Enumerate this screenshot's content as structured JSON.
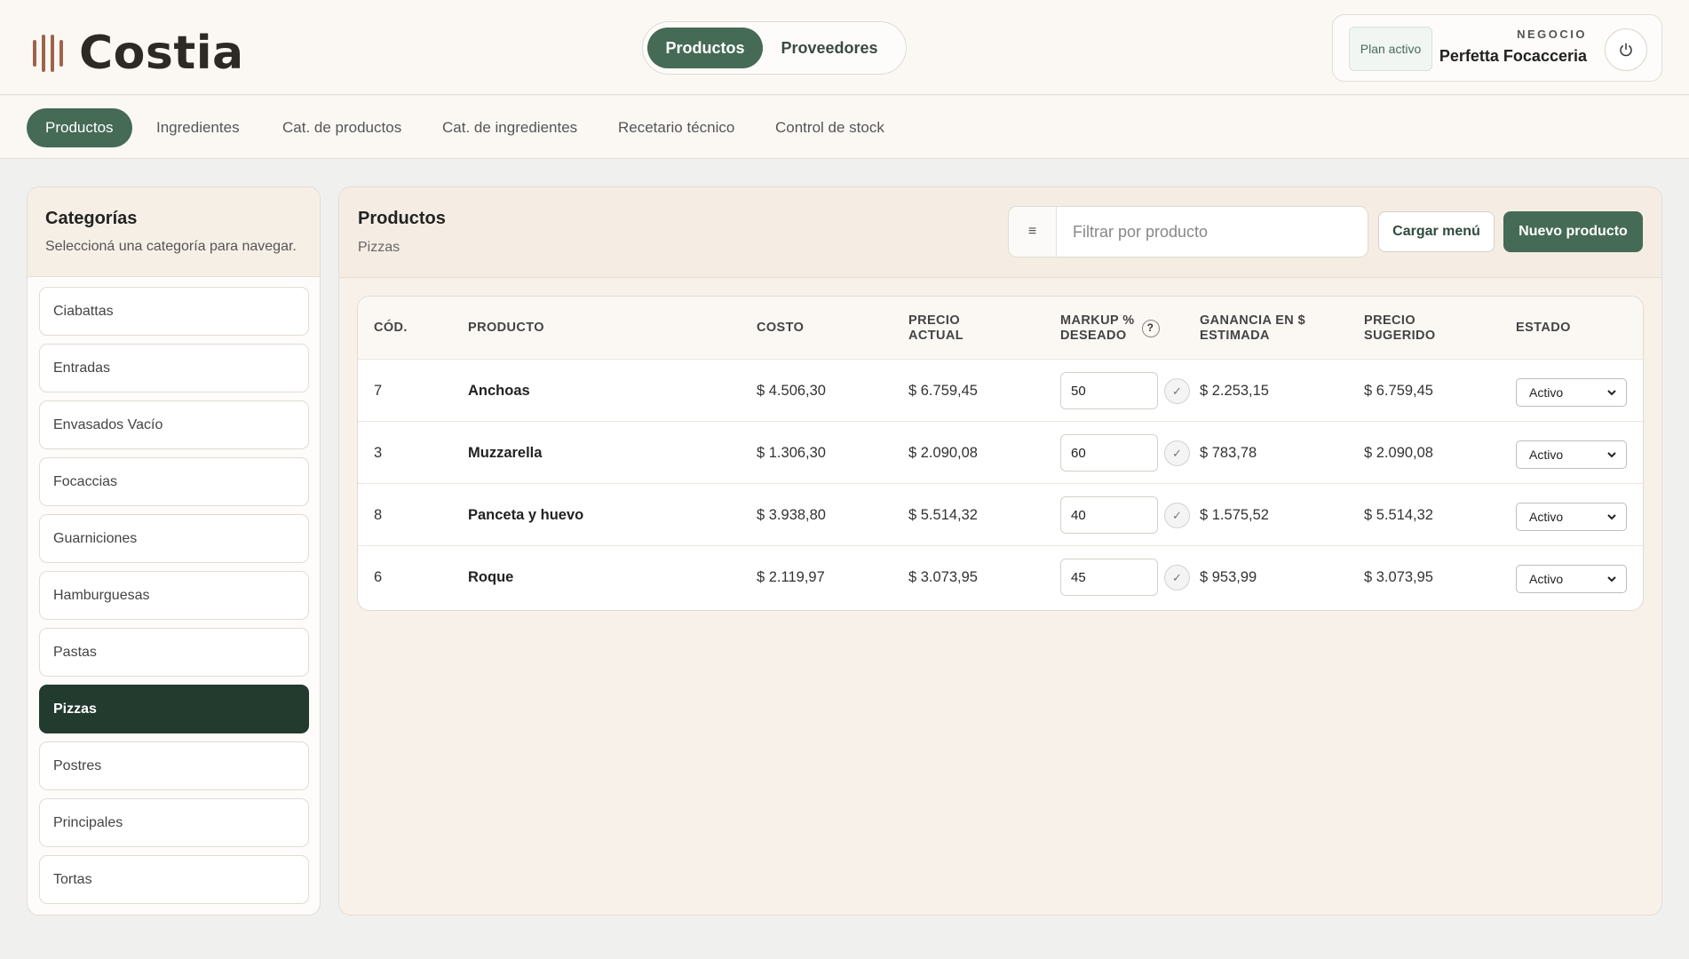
{
  "app": {
    "name": "Costia"
  },
  "top_toggle": {
    "active": "Productos",
    "inactive": "Proveedores"
  },
  "business": {
    "plan": "Plan activo",
    "label": "NEGOCIO",
    "name": "Perfetta Focacceria"
  },
  "subnav": [
    "Productos",
    "Ingredientes",
    "Cat. de productos",
    "Cat. de ingredientes",
    "Recetario técnico",
    "Control de stock"
  ],
  "sidebar": {
    "title": "Categorías",
    "subtitle": "Seleccioná una categoría para navegar.",
    "items": [
      "Ciabattas",
      "Entradas",
      "Envasados Vacío",
      "Focaccias",
      "Guarniciones",
      "Hamburguesas",
      "Pastas",
      "Pizzas",
      "Postres",
      "Principales",
      "Tortas"
    ],
    "selected": "Pizzas"
  },
  "main": {
    "title": "Productos",
    "subtitle": "Pizzas",
    "search_placeholder": "Filtrar por producto",
    "load_menu": "Cargar menú",
    "new_product": "Nuevo producto"
  },
  "table": {
    "headers": {
      "code": "CÓD.",
      "product": "PRODUCTO",
      "cost": "COSTO",
      "current_price_1": "PRECIO",
      "current_price_2": "ACTUAL",
      "markup_1": "MARKUP %",
      "markup_2": "DESEADO",
      "profit_1": "GANANCIA EN $",
      "profit_2": "ESTIMADA",
      "suggested_1": "PRECIO",
      "suggested_2": "SUGERIDO",
      "status": "ESTADO"
    },
    "rows": [
      {
        "code": "7",
        "product": "Anchoas",
        "cost": "$ 4.506,30",
        "current_price": "$ 6.759,45",
        "markup": "50",
        "profit": "$ 2.253,15",
        "suggested": "$ 6.759,45",
        "status": "Activo"
      },
      {
        "code": "3",
        "product": "Muzzarella",
        "cost": "$ 1.306,30",
        "current_price": "$ 2.090,08",
        "markup": "60",
        "profit": "$ 783,78",
        "suggested": "$ 2.090,08",
        "status": "Activo"
      },
      {
        "code": "8",
        "product": "Panceta y huevo",
        "cost": "$ 3.938,80",
        "current_price": "$ 5.514,32",
        "markup": "40",
        "profit": "$ 1.575,52",
        "suggested": "$ 5.514,32",
        "status": "Activo"
      },
      {
        "code": "6",
        "product": "Roque",
        "cost": "$ 2.119,97",
        "current_price": "$ 3.073,95",
        "markup": "45",
        "profit": "$ 953,99",
        "suggested": "$ 3.073,95",
        "status": "Activo"
      }
    ]
  },
  "colors": {
    "brand_green": "#456a55",
    "selected_dark": "#233a2e",
    "logo_accent": "#a0624a",
    "header_bg": "#fbf8f4"
  },
  "icons": [
    "logo-bars-icon",
    "power-icon",
    "filter-icon",
    "help-icon",
    "check-icon",
    "chevron-down-icon"
  ]
}
